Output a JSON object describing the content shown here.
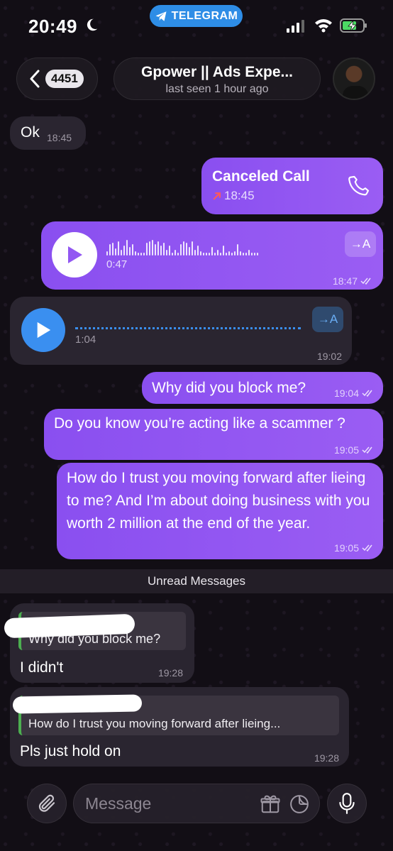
{
  "status_bar": {
    "time": "20:49",
    "app_pill": "TELEGRAM"
  },
  "header": {
    "back_count": "4451",
    "title": "Gpower || Ads Expe...",
    "subtitle": "last seen 1 hour ago"
  },
  "messages": [
    {
      "type": "text",
      "direction": "in",
      "text": "Ok",
      "time": "18:45"
    },
    {
      "type": "call",
      "direction": "out",
      "text": "Canceled Call",
      "time": "18:45"
    },
    {
      "type": "voice",
      "direction": "out",
      "duration": "0:47",
      "time": "18:47",
      "transcribe_label": "→A"
    },
    {
      "type": "voice",
      "direction": "in",
      "duration": "1:04",
      "time": "19:02",
      "transcribe_label": "→A"
    },
    {
      "type": "text",
      "direction": "out",
      "text": "Why did you block me?",
      "time": "19:04"
    },
    {
      "type": "text",
      "direction": "out",
      "text": "Do you know you’re acting like a scammer ?",
      "time": "19:05"
    },
    {
      "type": "text",
      "direction": "out",
      "text": "How do I trust you moving forward after lieing to me? And I’m about doing business with you worth 2 million at the end of the year.",
      "time": "19:05"
    }
  ],
  "unread_label": "Unread Messages",
  "replies": [
    {
      "quote": "Why did you block me?",
      "text": "I didn't",
      "time": "19:28"
    },
    {
      "quote": "How do I trust you moving forward after lieing...",
      "text": "Pls just hold on",
      "time": "19:28"
    }
  ],
  "composer": {
    "placeholder": "Message"
  },
  "colors": {
    "outgoing_bubble": "#9257f2",
    "incoming_bubble": "#2a2530",
    "telegram_blue": "#2e8de6",
    "reply_accent": "#4caf50"
  }
}
